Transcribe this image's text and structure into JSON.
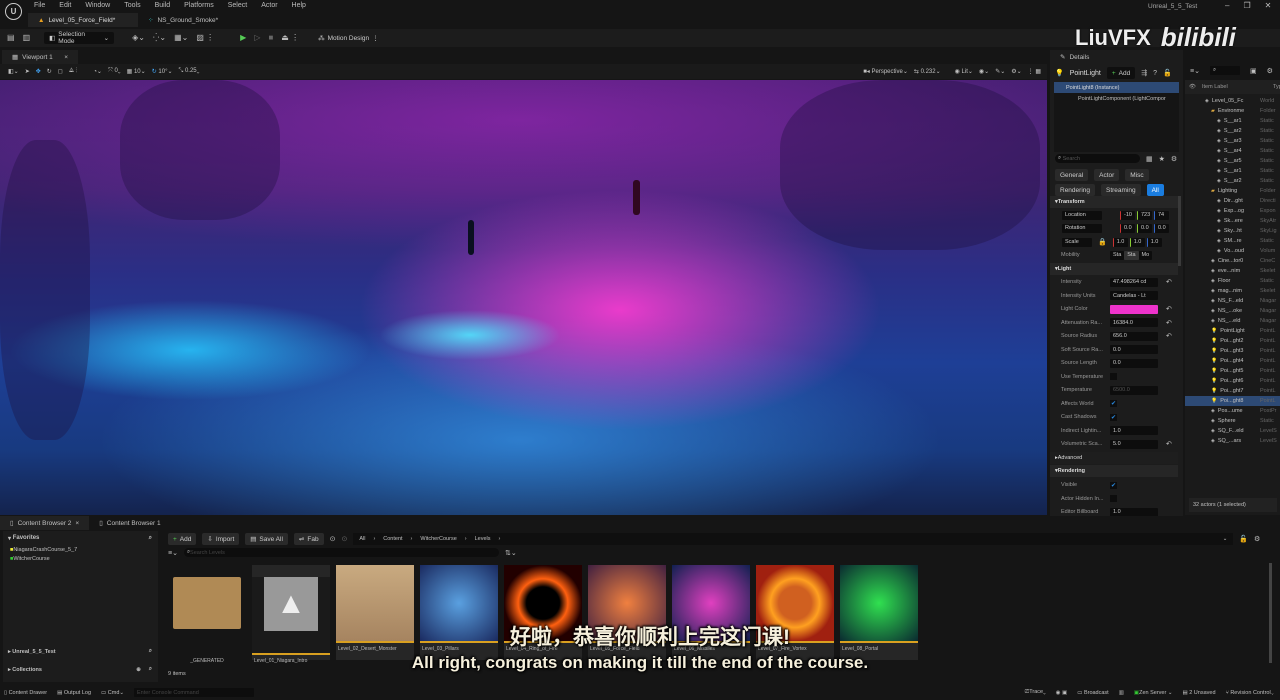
{
  "app": {
    "project": "Unreal_5_5_Test",
    "menus": [
      "File",
      "Edit",
      "Window",
      "Tools",
      "Build",
      "Platforms",
      "Select",
      "Actor",
      "Help"
    ],
    "doc_tabs": [
      "Level_05_Force_Field*",
      "NS_Ground_Smoke*"
    ]
  },
  "toolbar": {
    "selection_mode": "Selection Mode",
    "motion_design": "Motion Design"
  },
  "viewport": {
    "tab": "Viewport 1",
    "grid_move": "0",
    "grid_snap": "10",
    "rot_snap": "10°",
    "scale_snap": "0.25",
    "perspective": "Perspective",
    "cam_speed": "0.232",
    "view_mode": "Lit"
  },
  "watermark": {
    "author": "LiuVFX",
    "site": "bilibili"
  },
  "details": {
    "tab": "Details",
    "actor": "PointLight",
    "add": "Add",
    "tree": [
      "PointLight8 (Instance)",
      "PointLightComponent (LightCompor"
    ],
    "search_placeholder": "Search",
    "filters": [
      "General",
      "Actor",
      "Misc",
      "Rendering",
      "Streaming",
      "All"
    ],
    "sections": {
      "transform": "Transform",
      "light": "Light",
      "advanced": "Advanced",
      "rendering": "Rendering"
    },
    "location_label": "Location",
    "location": [
      "-10",
      "723",
      "74"
    ],
    "rotation_label": "Rotation",
    "rotation": [
      "0.0",
      "0.0",
      "0.0"
    ],
    "scale_label": "Scale",
    "scale": [
      "1.0",
      "1.0",
      "1.0"
    ],
    "mobility_label": "Mobility",
    "mobility": [
      "Sta",
      "Sta",
      "Mo"
    ],
    "props": [
      {
        "label": "Intensity",
        "value": "47.498264 cd"
      },
      {
        "label": "Intensity Units",
        "value": "Candelas - Lt"
      },
      {
        "label": "Light Color",
        "value": ""
      },
      {
        "label": "Attenuation Ra...",
        "value": "16384.0"
      },
      {
        "label": "Source Radius",
        "value": "656.0"
      },
      {
        "label": "Soft Source Ra...",
        "value": "0.0"
      },
      {
        "label": "Source Length",
        "value": "0.0"
      },
      {
        "label": "Use Temperature",
        "value": ""
      },
      {
        "label": "Temperature",
        "value": "6500.0"
      },
      {
        "label": "Affects World",
        "value": ""
      },
      {
        "label": "Cast Shadows",
        "value": ""
      },
      {
        "label": "Indirect Lightin...",
        "value": "1.0"
      },
      {
        "label": "Volumetric Sca...",
        "value": "5.0"
      }
    ],
    "render_props": [
      {
        "label": "Visible",
        "value": ""
      },
      {
        "label": "Actor Hidden In...",
        "value": ""
      },
      {
        "label": "Editor Billboard",
        "value": "1.0"
      }
    ],
    "light_color": "#ee33cc"
  },
  "outliner": {
    "col_label": "Item Label",
    "col_type": "Type",
    "items": [
      [
        "Level_05_Fc",
        "World",
        1
      ],
      [
        "Environme",
        "Folder",
        2
      ],
      [
        "S__ar1",
        "Static",
        3
      ],
      [
        "S__ar2",
        "Static",
        3
      ],
      [
        "S__ar3",
        "Static",
        3
      ],
      [
        "S__ar4",
        "Static",
        3
      ],
      [
        "S__ar5",
        "Static",
        3
      ],
      [
        "S__ar1",
        "Static",
        3
      ],
      [
        "S__ar2",
        "Static",
        3
      ],
      [
        "Lighting",
        "Folder",
        2
      ],
      [
        "Dir...ght",
        "Directi",
        3
      ],
      [
        "Exp...og",
        "Expon",
        3
      ],
      [
        "Sk...ere",
        "SkyAtr",
        3
      ],
      [
        "Sky...ht",
        "SkyLig",
        3
      ],
      [
        "SM...re",
        "Static",
        3
      ],
      [
        "Vo...oud",
        "Volum",
        3
      ],
      [
        "Cine...tor0",
        "CineC",
        2
      ],
      [
        "eve...nim",
        "Skelet",
        2
      ],
      [
        "Floor",
        "Static",
        2
      ],
      [
        "mag...nim",
        "Skelet",
        2
      ],
      [
        "NS_F...eld",
        "Niagar",
        2
      ],
      [
        "NS_...oke",
        "Niagar",
        2
      ],
      [
        "NS_...eld",
        "Niagar",
        2
      ],
      [
        "PointLight",
        "PointL",
        2
      ],
      [
        "Poi...ght2",
        "PointL",
        2
      ],
      [
        "Poi...ght3",
        "PointL",
        2
      ],
      [
        "Poi...ght4",
        "PointL",
        2
      ],
      [
        "Poi...ght5",
        "PointL",
        2
      ],
      [
        "Poi...ght6",
        "PointL",
        2
      ],
      [
        "Poi...ght7",
        "PointL",
        2
      ],
      [
        "Poi...ght8",
        "PointL",
        2
      ],
      [
        "Pos...ume",
        "PostPr",
        2
      ],
      [
        "Sphere",
        "Static",
        2
      ],
      [
        "SQ_F...eld",
        "LevelS",
        2
      ],
      [
        "SQ_...ars",
        "LevelS",
        2
      ]
    ],
    "selected": "Poi...ght8",
    "status": "32 actors (1 selected)"
  },
  "content": {
    "tabs": [
      "Content Browser 2",
      "Content Browser 1"
    ],
    "favorites": "Favorites",
    "fav_items": [
      "NiagaraCrashCourse_5_7",
      "WitcherCourse"
    ],
    "project": "Unreal_5_5_Test",
    "collections": "Collections",
    "add": "Add",
    "import": "Import",
    "save_all": "Save All",
    "fab": "Fab",
    "breadcrumb": [
      "All",
      "Content",
      "WitcherCourse",
      "Levels"
    ],
    "search_placeholder": "Search Levels",
    "assets": [
      "_GENERATED",
      "Level_01_Niagara_Intro",
      "Level_02_Desert_Monster",
      "Level_03_Pillars",
      "Level_04_Ring_of_Fire",
      "Level_05_Force_Field",
      "Level_06_Missiles",
      "Level_07_Fire_Vortex",
      "Level_08_Portal"
    ],
    "count": "9 items"
  },
  "statusbar": {
    "content_drawer": "Content Drawer",
    "output_log": "Output Log",
    "cmd": "Cmd",
    "console_placeholder": "Enter Console Command",
    "trace": "Trace",
    "broadcast": "Broadcast",
    "zen": "Zen Server",
    "unsaved": "2 Unsaved",
    "revision": "Revision Control"
  },
  "subtitles": {
    "zh": "好啦，恭喜你顺利上完这门课!",
    "en": "All right, congrats on making it till the end of the course."
  }
}
